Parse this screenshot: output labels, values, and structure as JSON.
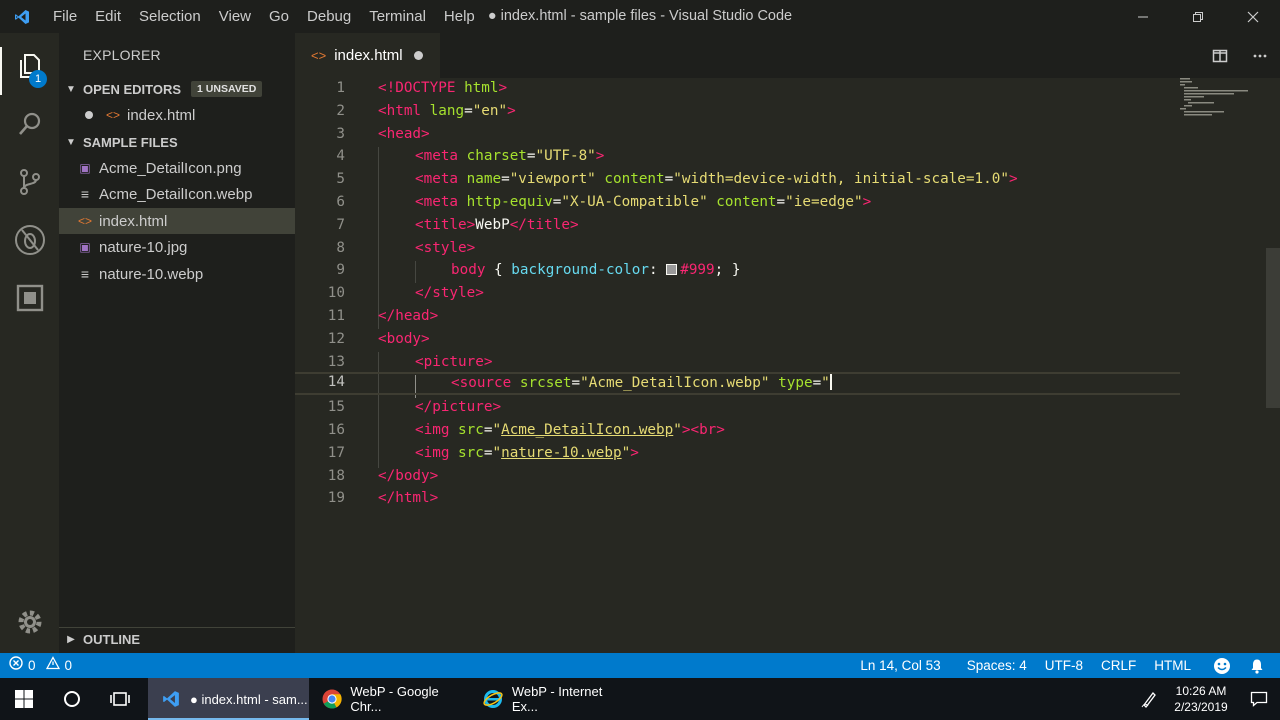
{
  "titlebar": {
    "menus": [
      "File",
      "Edit",
      "Selection",
      "View",
      "Go",
      "Debug",
      "Terminal",
      "Help"
    ],
    "window_title": "● index.html - sample files - Visual Studio Code"
  },
  "activity": {
    "explorer_badge": "1"
  },
  "sidebar": {
    "title": "EXPLORER",
    "open_editors_label": "OPEN EDITORS",
    "unsaved_badge": "1 UNSAVED",
    "open_editors": [
      {
        "name": "index.html"
      }
    ],
    "folder_label": "SAMPLE FILES",
    "files": [
      {
        "name": "Acme_DetailIcon.png",
        "icon": "image-file-icon"
      },
      {
        "name": "Acme_DetailIcon.webp",
        "icon": "text-file-icon"
      },
      {
        "name": "index.html",
        "icon": "html-file-icon"
      },
      {
        "name": "nature-10.jpg",
        "icon": "image-file-icon"
      },
      {
        "name": "nature-10.webp",
        "icon": "text-file-icon"
      }
    ],
    "outline_label": "OUTLINE"
  },
  "editor": {
    "tab_label": "index.html",
    "lines": [
      "1",
      "2",
      "3",
      "4",
      "5",
      "6",
      "7",
      "8",
      "9",
      "10",
      "11",
      "12",
      "13",
      "14",
      "15",
      "16",
      "17",
      "18",
      "19"
    ],
    "code": {
      "l1": [
        "<!DOCTYPE ",
        "html",
        ">"
      ],
      "l2": [
        "<html ",
        "lang",
        "=",
        "\"en\"",
        ">"
      ],
      "l3": [
        "<head>"
      ],
      "l4": [
        "<meta ",
        "charset",
        "=",
        "\"UTF-8\"",
        ">"
      ],
      "l5": [
        "<meta ",
        "name",
        "=",
        "\"viewport\"",
        " ",
        "content",
        "=",
        "\"width=device-width, initial-scale=1.0\"",
        ">"
      ],
      "l6": [
        "<meta ",
        "http-equiv",
        "=",
        "\"X-UA-Compatible\"",
        " ",
        "content",
        "=",
        "\"ie=edge\"",
        ">"
      ],
      "l7": [
        "<title>",
        "WebP",
        "</title>"
      ],
      "l8": [
        "<style>"
      ],
      "l9": [
        "body",
        " { ",
        "background-color",
        ": ",
        "#999",
        "; }"
      ],
      "l10": [
        "</style>"
      ],
      "l11": [
        "</head>"
      ],
      "l12": [
        "<body>"
      ],
      "l13": [
        "<picture>"
      ],
      "l14": [
        "<source ",
        "srcset",
        "=",
        "\"Acme_DetailIcon.webp\"",
        " ",
        "type",
        "=",
        "\""
      ],
      "l15": [
        "</picture>"
      ],
      "l16": [
        "<img ",
        "src",
        "=",
        "\"",
        "Acme_DetailIcon.webp",
        "\"",
        "><br>"
      ],
      "l17": [
        "<img ",
        "src",
        "=",
        "\"",
        "nature-10.webp",
        "\"",
        ">"
      ],
      "l18": [
        "</body>"
      ],
      "l19": [
        "</html>"
      ]
    }
  },
  "statusbar": {
    "errors": "0",
    "warnings": "0",
    "cursor": "Ln 14, Col 53",
    "spaces": "Spaces: 4",
    "encoding": "UTF-8",
    "eol": "CRLF",
    "language": "HTML"
  },
  "taskbar": {
    "apps": [
      {
        "label": "● index.html - sam..."
      },
      {
        "label": "WebP - Google Chr..."
      },
      {
        "label": "WebP - Internet Ex..."
      }
    ],
    "time": "10:26 AM",
    "date": "2/23/2019"
  },
  "colors": {
    "accent": "#007acc",
    "tag": "#f92672",
    "attr": "#a6e22e",
    "string": "#e6db74"
  }
}
